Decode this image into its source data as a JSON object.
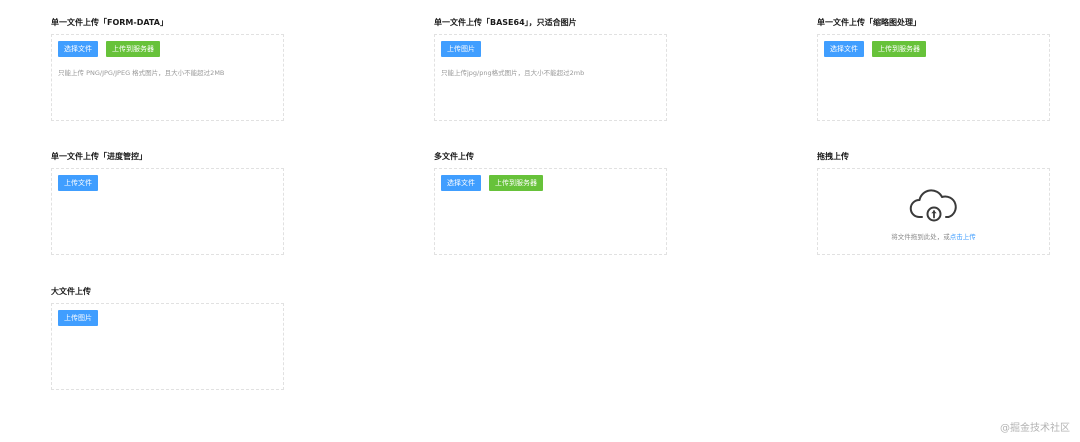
{
  "sections": [
    {
      "title": "单一文件上传「FORM-DATA」",
      "buttons": [
        "选择文件",
        "上传到服务器"
      ],
      "hint": "只能上传 PNG/JPG/JPEG 格式图片，且大小不能超过2MB"
    },
    {
      "title": "单一文件上传「BASE64」，只适合图片",
      "buttons": [
        "上传图片"
      ],
      "hint": "只能上传jpg/png格式图片，且大小不能超过2mb"
    },
    {
      "title": "单一文件上传「缩略图处理」",
      "buttons": [
        "选择文件",
        "上传到服务器"
      ]
    },
    {
      "title": "单一文件上传「进度管控」",
      "buttons": [
        "上传文件"
      ]
    },
    {
      "title": "多文件上传",
      "buttons": [
        "选择文件",
        "上传到服务器"
      ]
    },
    {
      "title": "拖拽上传",
      "drag_text": "将文件拖到此处，或",
      "drag_link": "点击上传"
    },
    {
      "title": "大文件上传",
      "buttons": [
        "上传图片"
      ]
    }
  ],
  "colors": {
    "primary": "#409eff",
    "success": "#67c23a"
  },
  "icons": {
    "cloud_upload": "cloud-upload-icon"
  },
  "watermark": "@掘金技术社区"
}
